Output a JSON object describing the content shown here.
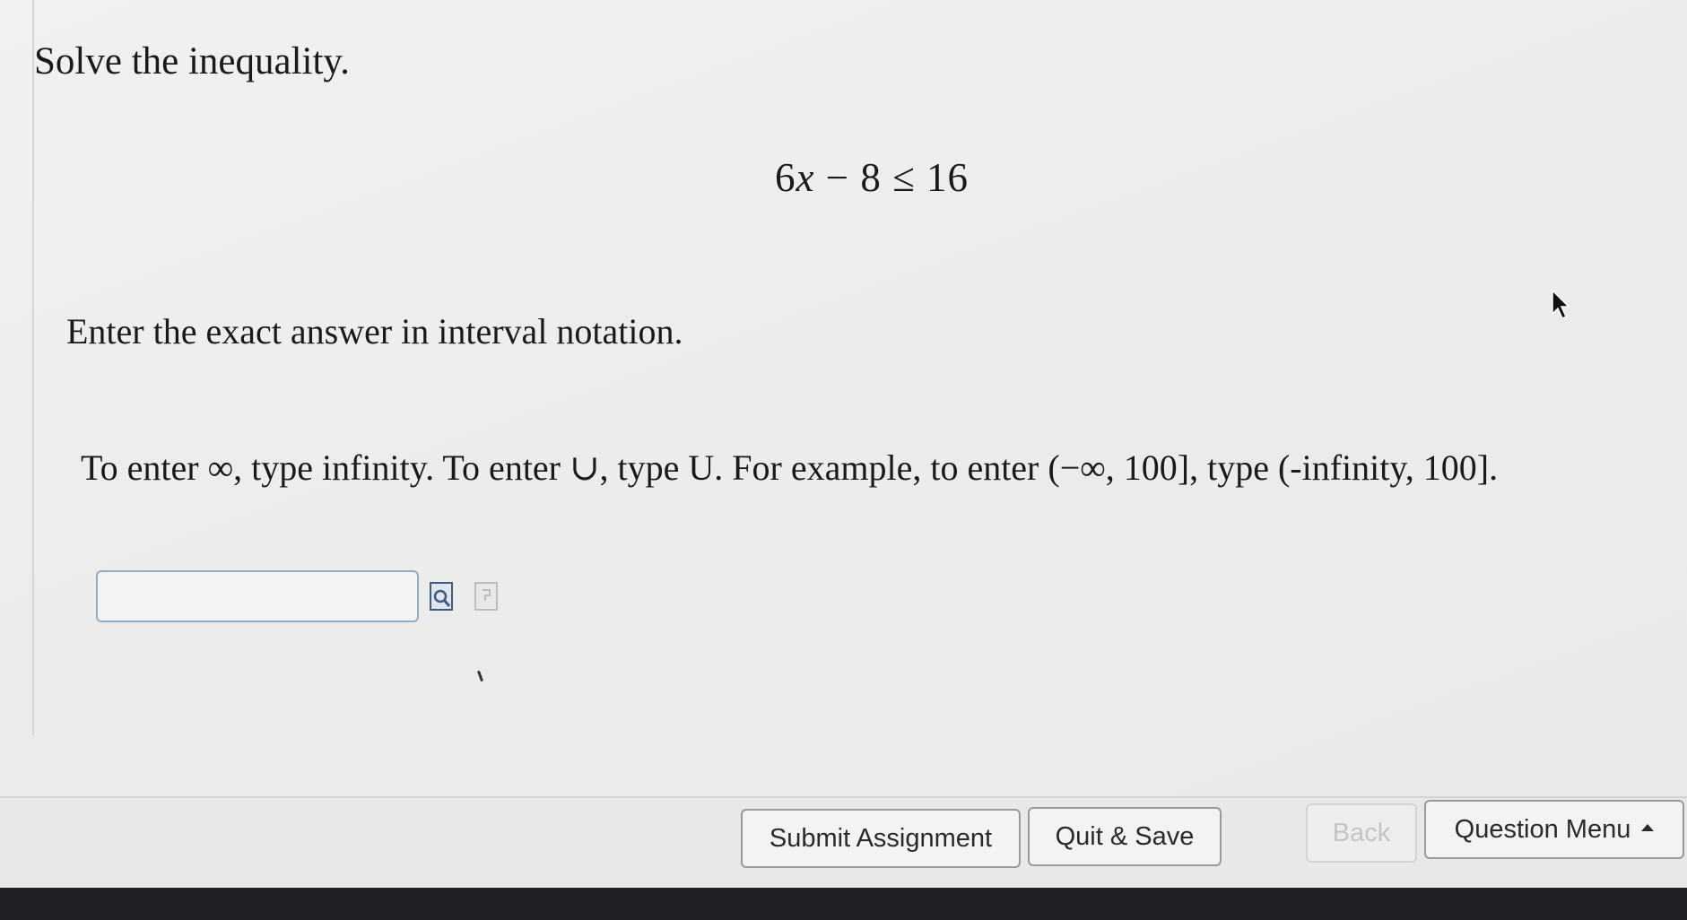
{
  "question": {
    "prompt": "Solve the inequality.",
    "equation": {
      "coef": "6",
      "var": "x",
      "rest": " − 8 ≤ 16"
    },
    "instruction": "Enter the exact answer in interval notation.",
    "hint": "To enter ∞, type infinity. To enter ∪, type U. For example, to enter (−∞, 100], type (-infinity, 100]."
  },
  "answer": {
    "value": "",
    "placeholder": ""
  },
  "footer": {
    "submit_label": "Submit Assignment",
    "quit_label": "Quit & Save",
    "back_label": "Back",
    "menu_label": "Question Menu"
  },
  "colors": {
    "input_border": "#8fb0cc",
    "footer_bg": "#e8e9e6",
    "disabled_text": "#c4c4c2"
  },
  "icons": [
    "preview-icon",
    "help-icon",
    "mouse-cursor-icon"
  ]
}
